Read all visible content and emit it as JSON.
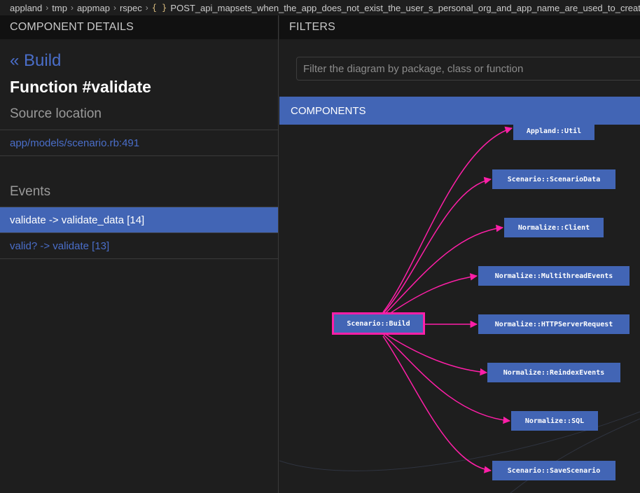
{
  "breadcrumb": {
    "items": [
      "appland",
      "tmp",
      "appmap",
      "rspec"
    ],
    "file_label": "POST_api_mapsets_when_the_app_does_not_exist_the_user_s_personal_org_and_app_name_are_used_to_create"
  },
  "details": {
    "header": "COMPONENT DETAILS",
    "back_label": "« Build",
    "function_title": "Function #validate",
    "source_title": "Source location",
    "source_path": "app/models/scenario.rb:491",
    "events_title": "Events",
    "events": [
      {
        "label": "validate -> validate_data [14]",
        "selected": true
      },
      {
        "label": "valid? -> validate [13]",
        "selected": false
      }
    ]
  },
  "filters": {
    "header": "FILTERS",
    "placeholder": "Filter the diagram by package, class or function"
  },
  "components": {
    "header": "COMPONENTS",
    "focus_node": "Scenario::Build",
    "nodes": [
      "Appland::Util",
      "Scenario::ScenarioData",
      "Normalize::Client",
      "Normalize::MultithreadEvents",
      "Normalize::HTTPServerRequest",
      "Normalize::ReindexEvents",
      "Normalize::SQL",
      "Scenario::SaveScenario"
    ]
  },
  "colors": {
    "accent": "#4265b5",
    "edge": "#ff1fa8",
    "link": "#4a6ec9"
  }
}
